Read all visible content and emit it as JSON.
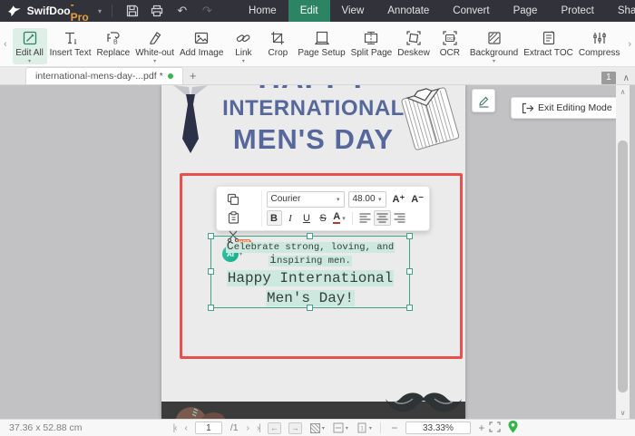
{
  "titlebar": {
    "app_name": "SwifDoo",
    "app_suffix": "-Pro",
    "menus": [
      {
        "label": "Home"
      },
      {
        "label": "Edit"
      },
      {
        "label": "View"
      },
      {
        "label": "Annotate"
      },
      {
        "label": "Convert"
      },
      {
        "label": "Page"
      },
      {
        "label": "Protect"
      },
      {
        "label": "Share"
      }
    ],
    "active_menu": "Edit"
  },
  "ribbon": {
    "items": [
      {
        "label": "Edit All",
        "active": true,
        "dropdown": true
      },
      {
        "label": "Insert Text"
      },
      {
        "label": "Replace"
      },
      {
        "label": "White-out",
        "dropdown": true
      },
      {
        "label": "Add Image"
      },
      {
        "label": "Link",
        "dropdown": true
      },
      {
        "label": "Crop"
      },
      {
        "label": "Page Setup"
      },
      {
        "label": "Split Page"
      },
      {
        "label": "Deskew"
      },
      {
        "label": "OCR"
      },
      {
        "label": "Background",
        "dropdown": true
      },
      {
        "label": "Extract TOC"
      },
      {
        "label": "Compress"
      }
    ]
  },
  "tabbar": {
    "tab_title": "international-mens-day-...pdf *",
    "page_badge": "1"
  },
  "document": {
    "heading_top": "HAPPY",
    "heading_mid": "INTERNATIONAL",
    "heading_bottom": "MEN'S DAY"
  },
  "format_toolbar": {
    "font_family_value": "Courier",
    "font_size_value": "48.00",
    "ai_label": "AI",
    "hot_badge": "HOT",
    "bold_label": "B",
    "italic_label": "I",
    "underline_label": "U",
    "strike_label": "S",
    "font_color_label": "A",
    "font_bigger_label": "A⁺",
    "font_smaller_label": "A⁻"
  },
  "textbox": {
    "line1": "Celebrate strong, loving, and",
    "line2": "inspiring men.",
    "line3": "Happy International",
    "line4": "Men's Day!"
  },
  "editing": {
    "exit_label": "Exit Editing Mode"
  },
  "statusbar": {
    "page_size": "37.36 x 52.88 cm",
    "current_page": "1",
    "page_total": "/1",
    "zoom_value": "33.33%"
  },
  "icons": {
    "dropdown_caret": "▾",
    "chevron_left": "‹",
    "chevron_right": "›",
    "chevron_up": "∧",
    "chevron_down": "∨",
    "undo": "↶",
    "redo": "↷",
    "minimize": "─",
    "maximize": "□",
    "close": "×",
    "add_tab": "+",
    "page_first": "|‹",
    "page_prev": "‹",
    "page_next": "›",
    "page_last": "›|",
    "nav_back": "←",
    "nav_forward": "→",
    "zoom_out": "−",
    "zoom_in": "+"
  },
  "colors": {
    "accent_green": "#2c8464",
    "pro_orange": "#e9a13b",
    "red_annotation": "#e8504d",
    "selection_teal": "#43a387",
    "text_highlight": "#cde8de",
    "heading_navy": "#56679b",
    "hot_orange": "#ff6b35"
  }
}
